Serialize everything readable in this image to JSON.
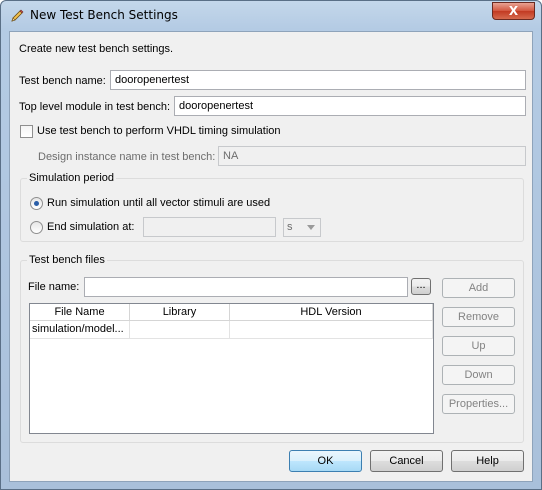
{
  "window": {
    "title": "New Test Bench Settings",
    "close_label": "X"
  },
  "intro_text": "Create new test bench settings.",
  "test_bench_name": {
    "label": "Test bench name:",
    "value": "dooropenertest"
  },
  "top_level_module": {
    "label": "Top level module in test bench:",
    "value": "dooropenertest"
  },
  "vhdl_timing": {
    "label": "Use test bench to perform VHDL timing simulation",
    "checked": false
  },
  "design_instance": {
    "label": "Design instance name in test bench:",
    "value": "NA"
  },
  "simulation_period": {
    "title": "Simulation period",
    "run_until_label": "Run simulation until all vector stimuli are used",
    "end_at_label": "End simulation at:",
    "end_at_value": "",
    "unit": "s",
    "selected": "run_until"
  },
  "test_bench_files": {
    "title": "Test bench files",
    "file_name_label": "File name:",
    "file_name_value": "",
    "browse_label": "...",
    "columns": [
      "File Name",
      "Library",
      "HDL Version"
    ],
    "rows": [
      [
        "simulation/model...",
        "",
        ""
      ]
    ],
    "buttons": {
      "add": "Add",
      "remove": "Remove",
      "up": "Up",
      "down": "Down",
      "properties": "Properties..."
    }
  },
  "footer": {
    "ok": "OK",
    "cancel": "Cancel",
    "help": "Help"
  }
}
